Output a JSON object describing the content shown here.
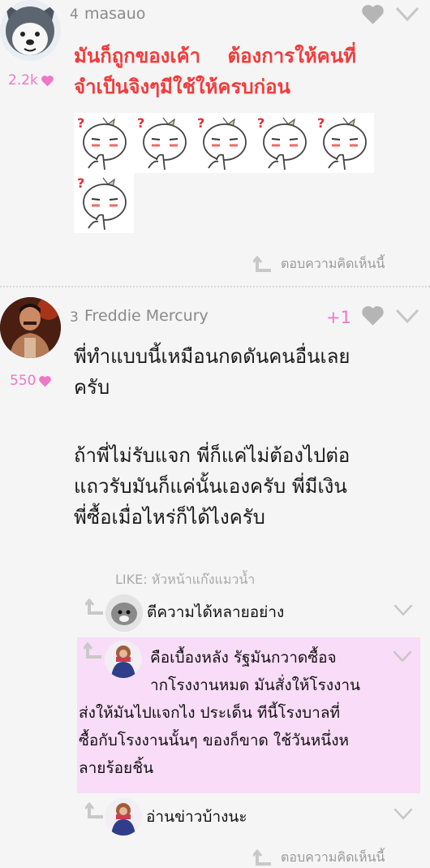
{
  "comments": [
    {
      "rank": "4",
      "username": "masauo",
      "points": "2.2k",
      "text_lines": [
        "มันก็ถูกของเค้า    ต้องการให้คนที่",
        "จำเป็นจิงๆมีใช้ให้ครบก่อน"
      ],
      "reply_label": "ตอบความคิดเห็นนี้",
      "sticker_count": 6
    },
    {
      "rank": "3",
      "username": "Freddie Mercury",
      "points": "550",
      "plus": "+1",
      "text_lines": [
        "พี่ทำแบบนี้เหมือนกดดันคนอื่นเลย",
        "ครับ",
        "",
        "ถ้าพี่ไม่รับแจก พี่ก็แค่ไม่ต้องไปต่อ",
        "แถวรับมันก็แค่นั้นเองครับ พี่มีเงิน",
        "พี่ซื้อเมื่อไหร่ก็ได้ไงครับ"
      ],
      "like_label": "LIKE: หัวหน้าแก๊งแมวน้ำ",
      "reply_label": "ตอบความคิดเห็นนี้",
      "subreplies": [
        {
          "text_lines": [
            "ตีความได้หลายอย่าง"
          ],
          "highlighted": false
        },
        {
          "text_lines": [
            "คือเบื้องหลัง รัฐมันกวาดซื้อจ",
            "ากโรงงานหมด มันสั่งให้โรงงาน",
            "ส่งให้มันไปแจกไง ประเด็น ทีนี้โรงบาลที่",
            "ซื้อกับโรงงานนั้นๆ ของก็ขาด ใช้วันหนึ่งห",
            "ลายร้อยชิ้น"
          ],
          "highlighted": true
        },
        {
          "text_lines": [
            "อ่านข่าวบ้างนะ"
          ],
          "highlighted": false
        }
      ]
    }
  ],
  "colors": {
    "red_text": "#f23b3b",
    "pink": "#ee77c8",
    "highlight_bg": "#f9dcf7",
    "grey": "#9a9a9a"
  },
  "icons": [
    "heart-icon",
    "chevron-down-icon",
    "reply-arrow-icon",
    "small-heart-icon"
  ]
}
